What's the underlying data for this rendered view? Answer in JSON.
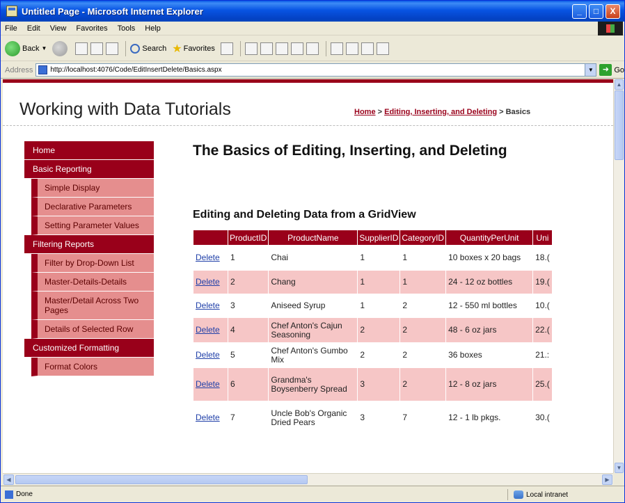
{
  "window": {
    "title": "Untitled Page - Microsoft Internet Explorer",
    "minimize": "_",
    "maximize": "□",
    "close": "X"
  },
  "menu": [
    "File",
    "Edit",
    "View",
    "Favorites",
    "Tools",
    "Help"
  ],
  "toolbar": {
    "back": "Back",
    "search": "Search",
    "favorites": "Favorites"
  },
  "address": {
    "label": "Address",
    "url": "http://localhost:4076/Code/EditInsertDelete/Basics.aspx",
    "go": "Go"
  },
  "site": {
    "title": "Working with Data Tutorials",
    "breadcrumb": {
      "home": "Home",
      "sep1": " > ",
      "section": "Editing, Inserting, and Deleting",
      "sep2": " > ",
      "current": "Basics"
    }
  },
  "nav": [
    {
      "label": "Home",
      "level": 1
    },
    {
      "label": "Basic Reporting",
      "level": 1
    },
    {
      "label": "Simple Display",
      "level": 2
    },
    {
      "label": "Declarative Parameters",
      "level": 2
    },
    {
      "label": "Setting Parameter Values",
      "level": 2
    },
    {
      "label": "Filtering Reports",
      "level": 1
    },
    {
      "label": "Filter by Drop-Down List",
      "level": 2
    },
    {
      "label": "Master-Details-Details",
      "level": 2
    },
    {
      "label": "Master/Detail Across Two Pages",
      "level": 2
    },
    {
      "label": "Details of Selected Row",
      "level": 2
    },
    {
      "label": "Customized Formatting",
      "level": 1
    },
    {
      "label": "Format Colors",
      "level": 2
    }
  ],
  "main": {
    "heading": "The Basics of Editing, Inserting, and Deleting",
    "subheading": "Editing and Deleting Data from a GridView"
  },
  "grid": {
    "columns": [
      "",
      "ProductID",
      "ProductName",
      "SupplierID",
      "CategoryID",
      "QuantityPerUnit",
      "Uni"
    ],
    "delete_label": "Delete",
    "rows": [
      {
        "id": "1",
        "name": "Chai",
        "supplier": "1",
        "category": "1",
        "qty": "10 boxes x 20 bags",
        "price": "18.("
      },
      {
        "id": "2",
        "name": "Chang",
        "supplier": "1",
        "category": "1",
        "qty": "24 - 12 oz bottles",
        "price": "19.("
      },
      {
        "id": "3",
        "name": "Aniseed Syrup",
        "supplier": "1",
        "category": "2",
        "qty": "12 - 550 ml bottles",
        "price": "10.("
      },
      {
        "id": "4",
        "name": "Chef Anton's Cajun Seasoning",
        "supplier": "2",
        "category": "2",
        "qty": "48 - 6 oz jars",
        "price": "22.("
      },
      {
        "id": "5",
        "name": "Chef Anton's Gumbo Mix",
        "supplier": "2",
        "category": "2",
        "qty": "36 boxes",
        "price": "21.:"
      },
      {
        "id": "6",
        "name": "Grandma's Boysenberry Spread",
        "supplier": "3",
        "category": "2",
        "qty": "12 - 8 oz jars",
        "price": "25.("
      },
      {
        "id": "7",
        "name": "Uncle Bob's Organic Dried Pears",
        "supplier": "3",
        "category": "7",
        "qty": "12 - 1 lb pkgs.",
        "price": "30.("
      }
    ]
  },
  "status": {
    "text": "Done",
    "zone": "Local intranet"
  }
}
